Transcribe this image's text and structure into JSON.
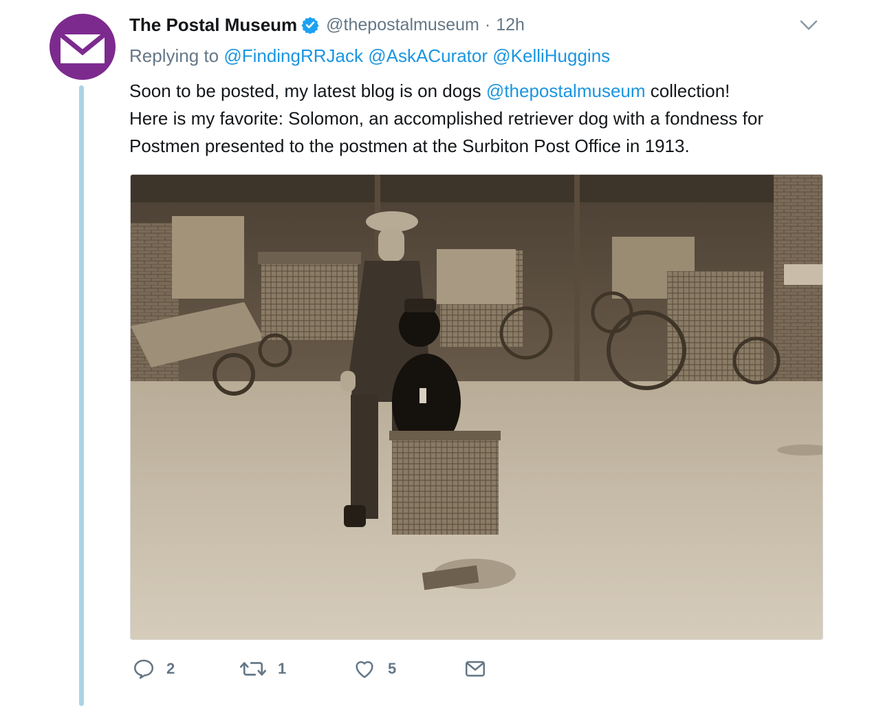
{
  "tweet": {
    "display_name": "The Postal Museum",
    "handle": "@thepostalmuseum",
    "separator": "·",
    "time": "12h",
    "replying_prefix": "Replying to",
    "replying_to": [
      "@FindingRRJack",
      "@AskACurator",
      "@KelliHuggins"
    ],
    "text_line1_before": "Soon to be posted, my latest blog is on dogs",
    "text_line1_mention": "@thepostalmuseum",
    "text_line1_after": "collection!",
    "text_line2": "Here is my favorite: Solomon, an accomplished retriever dog with a fondness for",
    "text_line3": "Postmen presented to the postmen at the Surbiton Post Office in 1913."
  },
  "actions": {
    "reply_count": "2",
    "retweet_count": "1",
    "like_count": "5"
  },
  "icons": {
    "avatar": "envelope-icon",
    "verified": "verified-badge-icon",
    "menu": "chevron-down-icon",
    "reply": "reply-icon",
    "retweet": "retweet-icon",
    "like": "heart-icon",
    "dm": "envelope-icon"
  },
  "colors": {
    "avatar_bg": "#7d2a8f",
    "link": "#1b95e0",
    "muted": "#657786",
    "thread_line": "#a9d4e3",
    "verified": "#1da1f2"
  }
}
